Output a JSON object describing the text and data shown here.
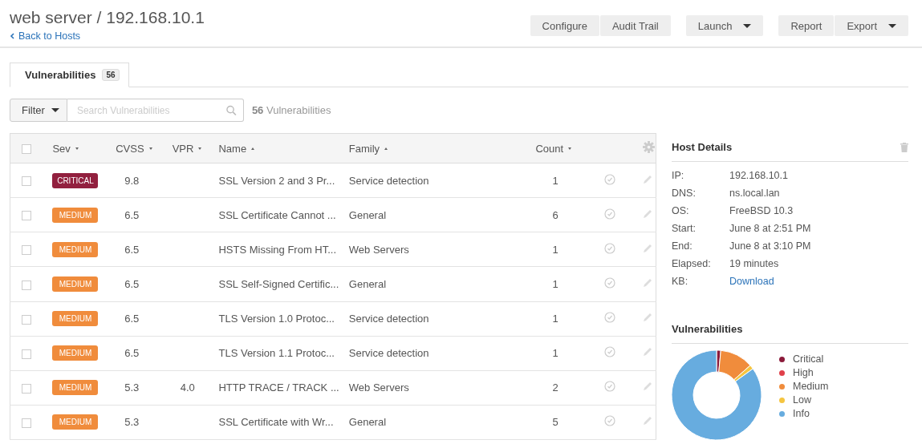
{
  "header": {
    "title": "web server / 192.168.10.1",
    "back_link": "Back to Hosts"
  },
  "toolbar": [
    {
      "group": [
        {
          "label": "Configure",
          "dropdown": false
        },
        {
          "label": "Audit Trail",
          "dropdown": false
        }
      ]
    },
    {
      "group": [
        {
          "label": "Launch",
          "dropdown": true
        }
      ]
    },
    {
      "group": [
        {
          "label": "Report",
          "dropdown": false
        },
        {
          "label": "Export",
          "dropdown": true
        }
      ]
    }
  ],
  "tabs": [
    {
      "label": "Vulnerabilities",
      "count": "56",
      "selected": true
    }
  ],
  "filter": {
    "button": "Filter",
    "placeholder": "Search Vulnerabilities",
    "result_count": "56",
    "result_label": "Vulnerabilities"
  },
  "table": {
    "select_all_checked": false,
    "columns": [
      {
        "label": "Sev",
        "ascending": false
      },
      {
        "label": "CVSS",
        "ascending": false
      },
      {
        "label": "VPR",
        "ascending": false
      },
      {
        "label": "Name",
        "ascending": true
      },
      {
        "label": "Family",
        "ascending": true
      },
      {
        "label": "Count",
        "ascending": false
      }
    ],
    "rows": [
      {
        "checked": false,
        "color": "#92203f",
        "sev": "CRITICAL",
        "cvss": "9.8",
        "name": "SSL Version 2 and 3 Pr...",
        "family": "Service detection",
        "count": "1"
      },
      {
        "checked": false,
        "color": "#f08c3c",
        "sev": "MEDIUM",
        "cvss": "6.5",
        "name": "SSL Certificate Cannot ...",
        "family": "General",
        "count": "6"
      },
      {
        "checked": false,
        "color": "#f08c3c",
        "sev": "MEDIUM",
        "cvss": "6.5",
        "name": "HSTS Missing From HT...",
        "family": "Web Servers",
        "count": "1"
      },
      {
        "checked": false,
        "color": "#f08c3c",
        "sev": "MEDIUM",
        "cvss": "6.5",
        "name": "SSL Self-Signed Certific...",
        "family": "General",
        "count": "1"
      },
      {
        "checked": false,
        "color": "#f08c3c",
        "sev": "MEDIUM",
        "cvss": "6.5",
        "name": "TLS Version 1.0 Protoc...",
        "family": "Service detection",
        "count": "1"
      },
      {
        "checked": false,
        "color": "#f08c3c",
        "sev": "MEDIUM",
        "cvss": "6.5",
        "name": "TLS Version 1.1 Protoc...",
        "family": "Service detection",
        "count": "1"
      },
      {
        "checked": false,
        "color": "#f08c3c",
        "sev": "MEDIUM",
        "cvss": "5.3",
        "vpr": "4.0",
        "name": "HTTP TRACE / TRACK ...",
        "family": "Web Servers",
        "count": "2"
      },
      {
        "checked": false,
        "color": "#f08c3c",
        "sev": "MEDIUM",
        "cvss": "5.3",
        "name": "SSL Certificate with Wr...",
        "family": "General",
        "count": "5"
      }
    ]
  },
  "host_details": {
    "title": "Host Details",
    "fields": [
      {
        "label": "IP:",
        "value": "192.168.10.1",
        "kind": "text"
      },
      {
        "label": "DNS:",
        "value": "ns.local.lan",
        "kind": "text"
      },
      {
        "label": "OS:",
        "value": "FreeBSD 10.3",
        "kind": "text"
      },
      {
        "label": "Start:",
        "value": "June 8 at 2:51 PM",
        "kind": "text"
      },
      {
        "label": "End:",
        "value": "June 8 at 3:10 PM",
        "kind": "text"
      },
      {
        "label": "Elapsed:",
        "value": "19 minutes",
        "kind": "text"
      },
      {
        "label": "KB:",
        "value": "Download",
        "kind": "link"
      }
    ]
  },
  "vulnerabilities_panel": {
    "title": "Vulnerabilities",
    "legend": [
      {
        "label": "Critical",
        "color": "#8b1a3a"
      },
      {
        "label": "High",
        "color": "#e0404a"
      },
      {
        "label": "Medium",
        "color": "#f08c3c"
      },
      {
        "label": "Low",
        "color": "#f5c540"
      },
      {
        "label": "Info",
        "color": "#67acdf"
      }
    ]
  }
}
